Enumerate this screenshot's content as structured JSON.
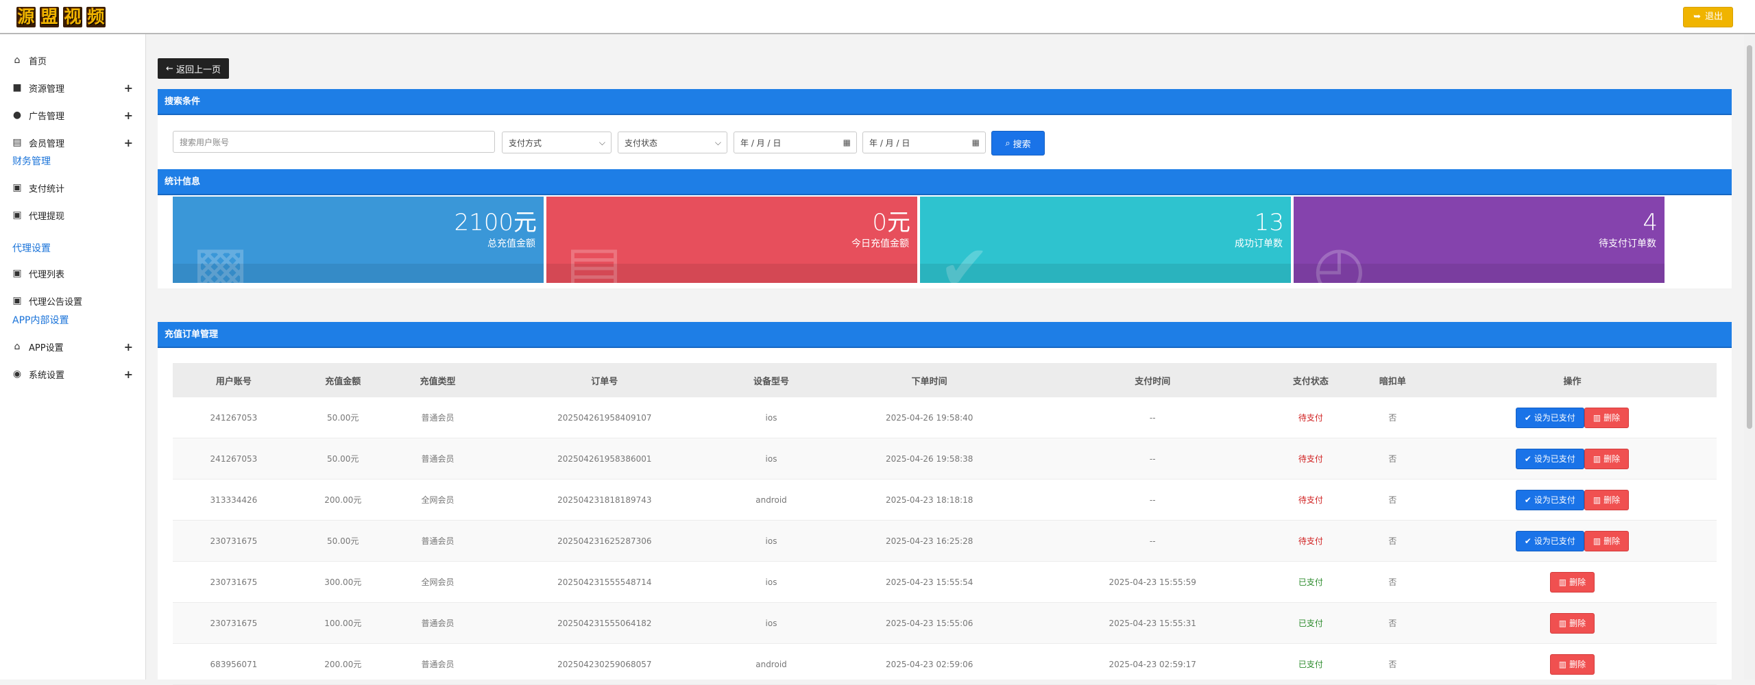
{
  "header": {
    "logo_chars": [
      "源",
      "盟",
      "视",
      "频"
    ],
    "logout_label": "退出"
  },
  "sidebar": {
    "items": [
      {
        "label": "首页",
        "icon": "home-icon",
        "has_plus": false
      },
      {
        "label": "资源管理",
        "icon": "video-icon",
        "has_plus": true
      },
      {
        "label": "广告管理",
        "icon": "globe-icon",
        "has_plus": true
      },
      {
        "label": "会员管理",
        "icon": "id-card-icon",
        "has_plus": true
      }
    ],
    "section_finance": "财务管理",
    "finance_items": [
      {
        "label": "支付统计",
        "icon": "user-square-icon"
      },
      {
        "label": "代理提现",
        "icon": "user-square-icon"
      }
    ],
    "section_agent": "代理设置",
    "agent_items": [
      {
        "label": "代理列表",
        "icon": "user-square-icon"
      },
      {
        "label": "代理公告设置",
        "icon": "user-square-icon"
      }
    ],
    "section_app": "APP内部设置",
    "app_items": [
      {
        "label": "APP设置",
        "icon": "home-icon",
        "has_plus": true
      },
      {
        "label": "系统设置",
        "icon": "user-circle-icon",
        "has_plus": true
      }
    ]
  },
  "main": {
    "back_label": "返回上一页",
    "search_panel_title": "搜索条件",
    "search": {
      "account_placeholder": "搜索用户账号",
      "pay_method": "支付方式",
      "pay_status": "支付状态",
      "date_start": "年 / 月 / 日",
      "date_end": "年 / 月 / 日",
      "button_label": "搜索"
    },
    "stats_panel_title": "统计信息",
    "stats": [
      {
        "value": "2100元",
        "label": "总充值金额",
        "color": "#3a97d8",
        "icon": "money-icon"
      },
      {
        "value": "0元",
        "label": "今日充值金额",
        "color": "#e74f5c",
        "icon": "card-icon"
      },
      {
        "value": "13",
        "label": "成功订单数",
        "color": "#2ec3cf",
        "icon": "check-icon"
      },
      {
        "value": "4",
        "label": "待支付订单数",
        "color": "#8543ad",
        "icon": "clock-icon"
      }
    ],
    "orders_panel_title": "充值订单管理",
    "table": {
      "headers": [
        "用户账号",
        "充值金额",
        "充值类型",
        "订单号",
        "设备型号",
        "下单时间",
        "支付时间",
        "支付状态",
        "暗扣单",
        "操作"
      ],
      "set_paid_label": "设为已支付",
      "delete_label": "删除",
      "rows": [
        {
          "account": "241267053",
          "amount": "50.00元",
          "type": "普通会员",
          "order": "202504261958409107",
          "device": "ios",
          "created": "2025-04-26 19:58:40",
          "paid_at": "--",
          "status": "待支付",
          "paid": false,
          "hidden": "否"
        },
        {
          "account": "241267053",
          "amount": "50.00元",
          "type": "普通会员",
          "order": "202504261958386001",
          "device": "ios",
          "created": "2025-04-26 19:58:38",
          "paid_at": "--",
          "status": "待支付",
          "paid": false,
          "hidden": "否"
        },
        {
          "account": "313334426",
          "amount": "200.00元",
          "type": "全网会员",
          "order": "202504231818189743",
          "device": "android",
          "created": "2025-04-23 18:18:18",
          "paid_at": "--",
          "status": "待支付",
          "paid": false,
          "hidden": "否"
        },
        {
          "account": "230731675",
          "amount": "50.00元",
          "type": "普通会员",
          "order": "202504231625287306",
          "device": "ios",
          "created": "2025-04-23 16:25:28",
          "paid_at": "--",
          "status": "待支付",
          "paid": false,
          "hidden": "否"
        },
        {
          "account": "230731675",
          "amount": "300.00元",
          "type": "全网会员",
          "order": "202504231555548714",
          "device": "ios",
          "created": "2025-04-23 15:55:54",
          "paid_at": "2025-04-23 15:55:59",
          "status": "已支付",
          "paid": true,
          "hidden": "否"
        },
        {
          "account": "230731675",
          "amount": "100.00元",
          "type": "普通会员",
          "order": "202504231555064182",
          "device": "ios",
          "created": "2025-04-23 15:55:06",
          "paid_at": "2025-04-23 15:55:31",
          "status": "已支付",
          "paid": true,
          "hidden": "否"
        },
        {
          "account": "683956071",
          "amount": "200.00元",
          "type": "普通会员",
          "order": "202504230259068057",
          "device": "android",
          "created": "2025-04-23 02:59:06",
          "paid_at": "2025-04-23 02:59:17",
          "status": "已支付",
          "paid": true,
          "hidden": "否"
        }
      ]
    }
  }
}
